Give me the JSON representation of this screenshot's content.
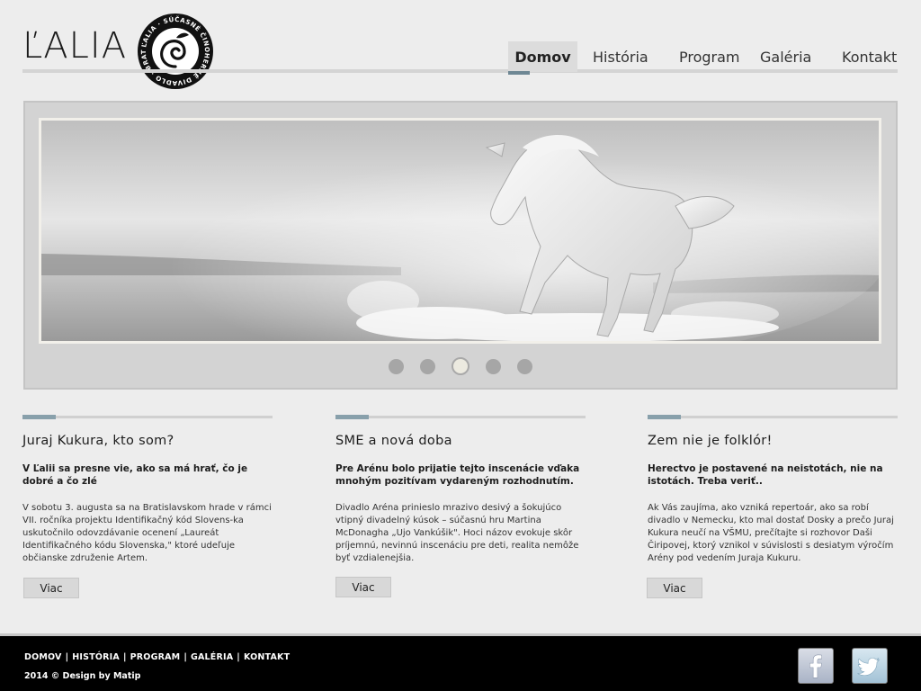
{
  "header": {
    "logo_text": "ĽALIA",
    "seal_text": "ĽALIA · SÚČASNÉ ČINOHERNÉ DIVADLO · BRATISLAVA"
  },
  "nav": [
    {
      "label": "Domov",
      "active": true
    },
    {
      "label": "História",
      "active": false
    },
    {
      "label": "Program",
      "active": false
    },
    {
      "label": "Galéria",
      "active": false
    },
    {
      "label": "Kontakt",
      "active": false
    }
  ],
  "slider": {
    "image": "white-horse-running-image",
    "slide_count": 5,
    "active_index": 2
  },
  "articles": [
    {
      "title": "Juraj Kukura, kto som?",
      "lead": "V Ľalii sa presne vie, ako sa má hrať, čo je dobré a čo zlé",
      "body": "V sobotu 3. augusta sa na Bratislavskom hrade v rámci VII. ročníka projektu Identifikačný kód Slovens-ka uskutočnilo odovzdávanie ocenení „Laureát Identifikačného kódu Slovenska,\" ktoré udeľuje občianske združenie Artem.",
      "button": "Viac"
    },
    {
      "title": "SME a nová doba",
      "lead": "Pre Arénu bolo prijatie tejto inscenácie vďaka mnohým pozitívam vydareným rozhodnutím.",
      "body": "Divadlo Aréna prinieslo mrazivo desivý a šokujúco vtipný divadelný kúsok – súčasnú hru Martina McDonagha „Ujo Vankúšik\". Hoci názov evokuje skôr príjemnú, nevinnú inscenáciu pre deti, realita nemôže byť vzdialenejšia.",
      "button": "Viac"
    },
    {
      "title": "Zem nie je folklór!",
      "lead": "Herectvo je postavené na neistotách, nie na istotách. Treba veriť..",
      "body": "Ak Vás zaujíma, ako vzniká repertoár, ako sa robí divadlo v Nemecku, kto mal dostať Dosky a prečo Juraj Kukura neučí na VŠMU, prečítajte si rozhovor Daši Čiripovej, ktorý vznikol v súvislosti s desiatym výročím Arény pod vedením Juraja Kukuru.",
      "button": "Viac"
    }
  ],
  "footer": {
    "links": [
      "DOMOV",
      "HISTÓRIA",
      "PROGRAM",
      "GALÉRIA",
      "KONTAKT"
    ],
    "separator": "|",
    "copyright": "2014 © Design by Matip",
    "social": [
      {
        "name": "facebook-icon",
        "glyph": "f"
      },
      {
        "name": "twitter-icon",
        "glyph": "t"
      }
    ]
  },
  "colors": {
    "background": "#ededed",
    "accent": "#6e8794",
    "footer": "#000000"
  }
}
